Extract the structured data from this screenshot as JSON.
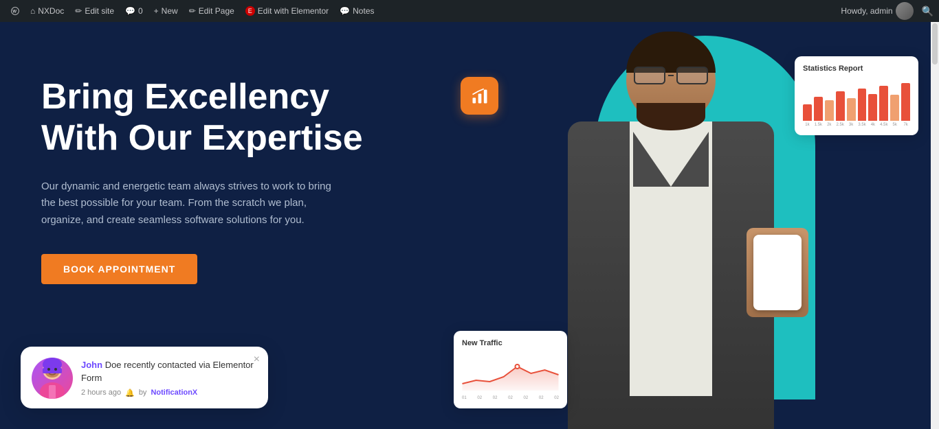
{
  "adminBar": {
    "wpLogo": "⊞",
    "siteName": "NXDoc",
    "editSite": "Edit site",
    "comments": "0",
    "new": "New",
    "editPage": "Edit Page",
    "editWithElementor": "Edit with Elementor",
    "notes": "Notes",
    "howdy": "Howdy, admin",
    "searchPlaceholder": "Search"
  },
  "hero": {
    "title": "Bring Excellency With Our Expertise",
    "description": "Our dynamic and energetic team always strives to work to bring the best possible for your team. From the scratch we plan, organize, and create seamless software solutions for you.",
    "buttonLabel": "BOOK APPOINTMENT"
  },
  "statsCard": {
    "title": "Statistics Report",
    "bars": [
      30,
      45,
      38,
      55,
      42,
      60,
      50,
      65,
      48,
      70
    ],
    "labels": [
      "1k",
      "1.5k",
      "2k",
      "2.5k",
      "3k",
      "3.5k",
      "4k",
      "4.5k",
      "5k",
      "7k"
    ]
  },
  "trafficCard": {
    "title": "New Traffic",
    "chartLabels": [
      "01",
      "02",
      "02",
      "02",
      "02",
      "02",
      "02"
    ]
  },
  "notification": {
    "name": "John",
    "text": " Doe recently contacted via Elementor Form",
    "timeAgo": "2 hours ago",
    "brand": "NotificationX",
    "closeLabel": "×"
  },
  "orangeBadge": {
    "icon": "chart-bar"
  },
  "colors": {
    "accent": "#f07b22",
    "teal": "#1ebfbf",
    "darkBg": "#0f2044",
    "purple": "#6d4aff"
  }
}
